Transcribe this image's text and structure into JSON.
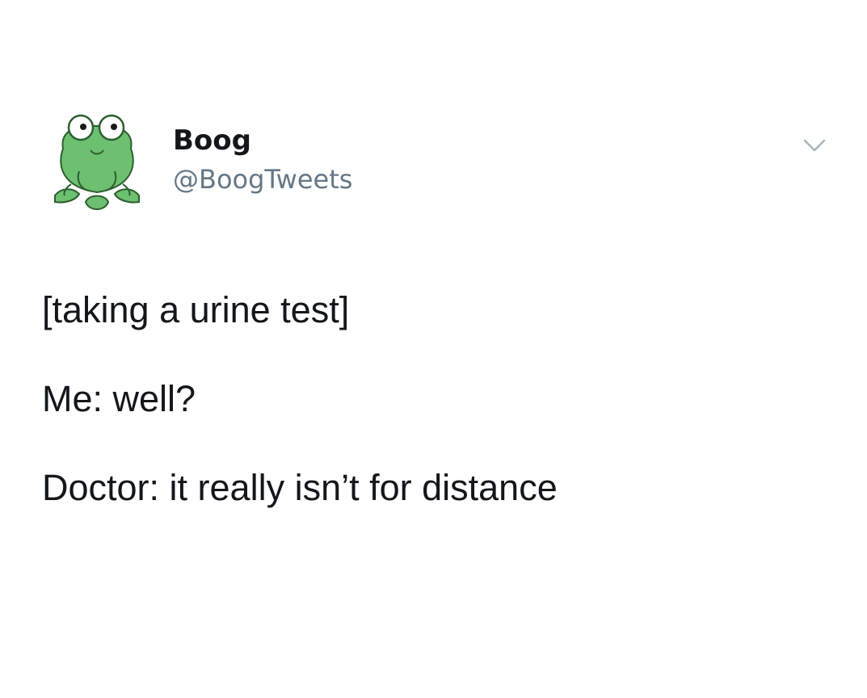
{
  "tweet": {
    "author": {
      "display_name": "Boog",
      "handle": "@BoogTweets",
      "avatar_icon": "frog-avatar-icon"
    },
    "menu_icon": "chevron-down-icon",
    "text_lines": [
      "[taking a urine test]",
      "Me: well?",
      "Doctor: it really isn’t for distance"
    ]
  },
  "colors": {
    "background": "#ffffff",
    "text": "#14171a",
    "handle": "#657786",
    "avatar_green": "#6cc070",
    "icon_gray": "#a9b4bd"
  }
}
